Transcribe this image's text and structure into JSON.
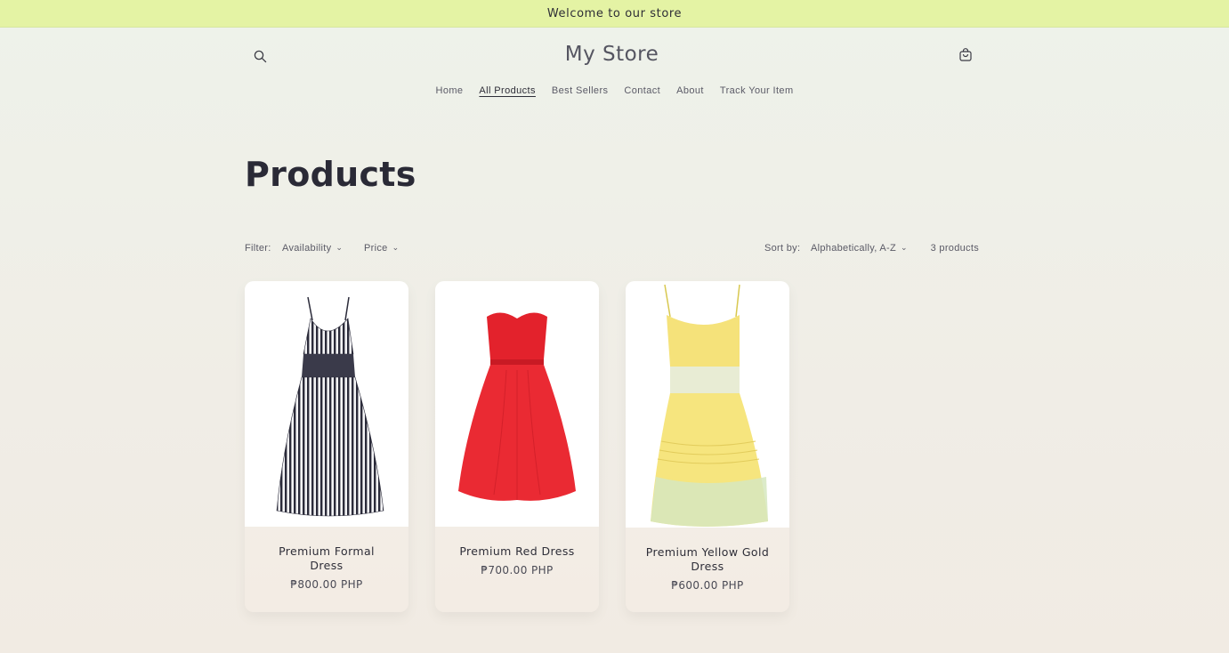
{
  "announcement": {
    "text": "Welcome to our store"
  },
  "header": {
    "title": "My Store",
    "search_icon": "search-icon",
    "cart_icon": "cart-icon"
  },
  "nav": {
    "items": [
      {
        "label": "Home"
      },
      {
        "label": "All Products"
      },
      {
        "label": "Best Sellers"
      },
      {
        "label": "Contact"
      },
      {
        "label": "About"
      },
      {
        "label": "Track Your Item"
      }
    ],
    "active": "All Products"
  },
  "main": {
    "title": "Products"
  },
  "filters": {
    "label": "Filter:",
    "availability": "Availability",
    "price": "Price",
    "sort_label": "Sort by:",
    "sort_value": "Alphabetically, A-Z",
    "count": "3 products"
  },
  "products": [
    {
      "name": "Premium Formal Dress",
      "price": "₱800.00 PHP",
      "image": "striped-dress"
    },
    {
      "name": "Premium Red Dress",
      "price": "₱700.00 PHP",
      "image": "red-dress"
    },
    {
      "name": "Premium Yellow Gold Dress",
      "price": "₱600.00 PHP",
      "image": "yellow-dress"
    }
  ],
  "colors": {
    "announcement_bg": "#e4f3a4",
    "page_bg": "#eef2ea",
    "text_dark": "#2a2a36"
  }
}
